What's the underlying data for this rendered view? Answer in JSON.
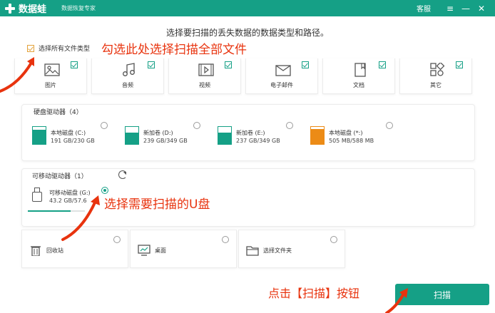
{
  "titlebar": {
    "app_name": "数据蛙",
    "app_subtitle": "数据恢复专家",
    "service_label": "客服",
    "menu_icon": "menu-icon",
    "minimize_icon": "minimize-icon",
    "close_icon": "close-icon"
  },
  "instruction": "选择要扫描的丢失数据的数据类型和路径。",
  "select_all": {
    "label": "选择所有文件类型",
    "checked": true
  },
  "annotations": {
    "select_all_hint": "勾选此处选择扫描全部文件",
    "usb_hint": "选择需要扫描的U盘",
    "scan_hint": "点击【扫描】按钮"
  },
  "file_types": [
    {
      "label": "图片",
      "icon": "image-icon",
      "checked": true
    },
    {
      "label": "音频",
      "icon": "music-icon",
      "checked": true
    },
    {
      "label": "视频",
      "icon": "video-icon",
      "checked": true
    },
    {
      "label": "电子邮件",
      "icon": "mail-icon",
      "checked": true
    },
    {
      "label": "文档",
      "icon": "document-icon",
      "checked": true
    },
    {
      "label": "其它",
      "icon": "other-icon",
      "checked": true
    }
  ],
  "hard_drives": {
    "title": "硬盘驱动器（4）",
    "items": [
      {
        "name": "本地磁盘 (C:)",
        "size": "191 GB/230 GB",
        "used_fraction": 0.83,
        "color": "#15a086"
      },
      {
        "name": "新加卷 (D:)",
        "size": "239 GB/349 GB",
        "used_fraction": 0.68,
        "color": "#15a086"
      },
      {
        "name": "新加卷 (E:)",
        "size": "237 GB/349 GB",
        "used_fraction": 0.68,
        "color": "#15a086"
      },
      {
        "name": "本地磁盘 (*:)",
        "size": "505 MB/588 MB",
        "used_fraction": 0.86,
        "color": "#ec8b16"
      }
    ]
  },
  "removable": {
    "title": "可移动驱动器（1）",
    "refresh_icon": "refresh-icon",
    "item": {
      "name": "可移动磁盘 (G:)",
      "size": "43.2 GB/57.6",
      "used_fraction": 0.75,
      "selected": true
    }
  },
  "locations": [
    {
      "label": "回收站",
      "icon": "trash-icon"
    },
    {
      "label": "桌面",
      "icon": "desktop-icon"
    },
    {
      "label": "选择文件夹",
      "icon": "folder-icon"
    }
  ],
  "scan_button": "扫描",
  "colors": {
    "brand": "#15a086",
    "annotation": "#e8330e",
    "accent_orange": "#ec8b16"
  }
}
